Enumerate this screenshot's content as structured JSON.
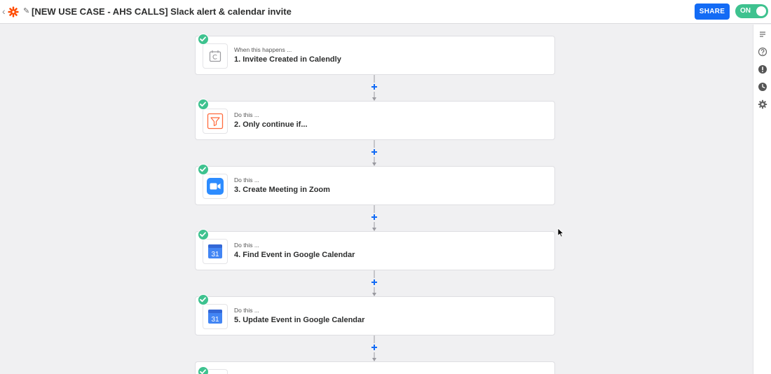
{
  "header": {
    "back_glyph": "‹",
    "edit_glyph": "✎",
    "title": "[NEW USE CASE - AHS CALLS] Slack alert & calendar invite",
    "share_label": "SHARE",
    "toggle_label": "ON"
  },
  "colors": {
    "accent": "#136bf5",
    "success": "#3ec28f",
    "zapier_orange": "#ff4a00",
    "filter_orange": "#ff6b3d"
  },
  "steps": [
    {
      "kicker": "When this happens ...",
      "title": "1. Invitee Created in Calendly",
      "icon": "calendly-icon"
    },
    {
      "kicker": "Do this ...",
      "title": "2. Only continue if...",
      "icon": "filter-icon"
    },
    {
      "kicker": "Do this ...",
      "title": "3. Create Meeting in Zoom",
      "icon": "zoom-icon"
    },
    {
      "kicker": "Do this ...",
      "title": "4. Find Event in Google Calendar",
      "icon": "google-calendar-icon",
      "icon_text": "31"
    },
    {
      "kicker": "Do this ...",
      "title": "5. Update Event in Google Calendar",
      "icon": "google-calendar-icon",
      "icon_text": "31"
    },
    {
      "kicker": "",
      "title": "",
      "icon": ""
    }
  ],
  "rail": [
    "notes-icon",
    "help-icon",
    "alert-icon",
    "history-icon",
    "settings-icon"
  ]
}
